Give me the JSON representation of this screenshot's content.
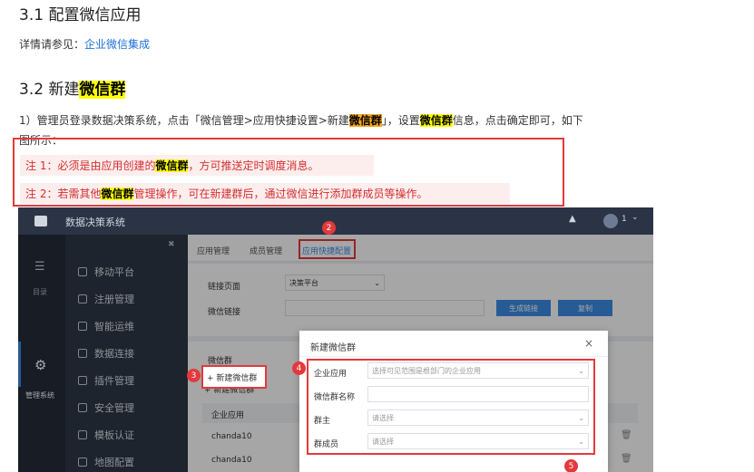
{
  "section1": {
    "title": "3.1 配置微信应用",
    "detail_prefix": "详情请参见：",
    "detail_link": "企业微信集成"
  },
  "section2": {
    "title_prefix": "3.2 新建",
    "title_hl": "微信群",
    "step1_a": "1）管理员登录数据决策系统，点击「微信管理>应用快捷设置>新建",
    "step1_hl": "微信群",
    "step1_b": "」，设置",
    "step1_hl2": "微信群",
    "step1_c": "信息，点击确定即可，如下",
    "step1_d": "图所示："
  },
  "notes": {
    "n1_a": "注 1：必须是由应用创建的",
    "n1_hl": "微信群",
    "n1_b": "，方可推送定时调度消息。",
    "n2_a": "注 2：若需其他",
    "n2_hl": "微信群",
    "n2_b": "管理操作，可在新建群后，通过微信进行添加群成员等操作。"
  },
  "screenshot": {
    "app_title": "数据决策系统",
    "user_label": "1",
    "left_nav": [
      {
        "label": "目录",
        "icon": "list-icon"
      },
      {
        "label": "管理系统",
        "icon": "gear-icon"
      }
    ],
    "menu": [
      "移动平台",
      "注册管理",
      "智能运维",
      "数据连接",
      "插件管理",
      "安全管理",
      "模板认证",
      "地图配置"
    ],
    "tabs": [
      "应用管理",
      "成员管理",
      "应用快捷配置"
    ],
    "link_page_label": "链接页面",
    "link_page_value": "决策平台",
    "wechat_link_label": "微信链接",
    "generate_btn": "生成链接",
    "copy_btn": "复制",
    "group_section_label": "微信群",
    "new_group_btn": "+ 新建微信群",
    "table_header": "企业应用",
    "rows": [
      "chanda10",
      "chanda10"
    ],
    "badges": [
      "2",
      "3",
      "4",
      "5"
    ],
    "modal": {
      "title": "新建微信群",
      "close": "×",
      "fields": [
        {
          "label": "企业应用",
          "placeholder": "选择可见范围是根部门的企业应用"
        },
        {
          "label": "微信群名称",
          "placeholder": ""
        },
        {
          "label": "群主",
          "placeholder": "请选择"
        },
        {
          "label": "群成员",
          "placeholder": "请选择"
        }
      ]
    }
  }
}
